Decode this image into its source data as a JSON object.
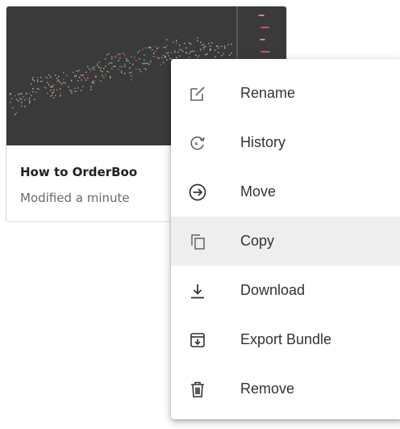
{
  "card": {
    "title": "How to OrderBoo",
    "subtitle": "Modified a minute"
  },
  "menu": {
    "items": [
      {
        "id": "rename",
        "label": "Rename",
        "icon": "rename-icon"
      },
      {
        "id": "history",
        "label": "History",
        "icon": "history-icon"
      },
      {
        "id": "move",
        "label": "Move",
        "icon": "move-icon"
      },
      {
        "id": "copy",
        "label": "Copy",
        "icon": "copy-icon",
        "highlighted": true
      },
      {
        "id": "download",
        "label": "Download",
        "icon": "download-icon"
      },
      {
        "id": "export-bundle",
        "label": "Export Bundle",
        "icon": "export-bundle-icon"
      },
      {
        "id": "remove",
        "label": "Remove",
        "icon": "trash-icon"
      }
    ]
  },
  "colors": {
    "menu_text": "#333333",
    "icon": "#5f6368",
    "hover_bg": "#eeeeee",
    "thumb_bg": "#3a3a3a"
  }
}
